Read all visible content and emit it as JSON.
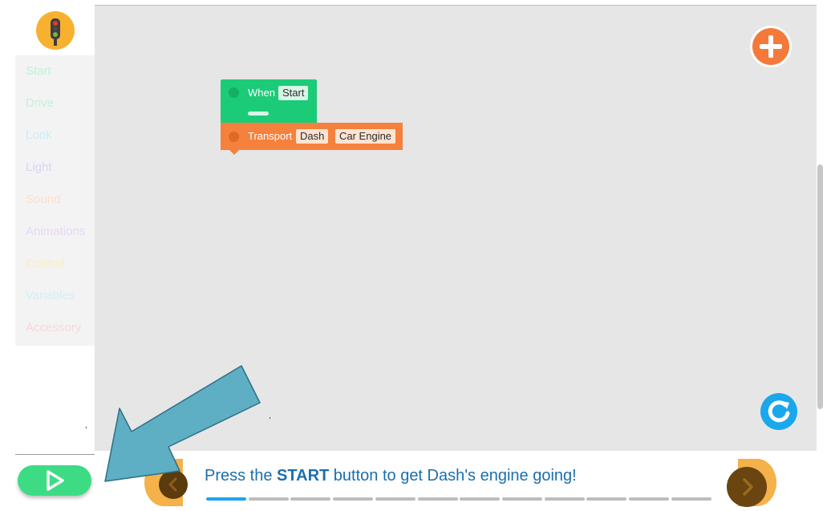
{
  "sidebar": {
    "logo_icon": "traffic-light-icon",
    "categories": [
      {
        "label": "Start",
        "color": "#bff3d8"
      },
      {
        "label": "Drive",
        "color": "#bff3d8"
      },
      {
        "label": "Look",
        "color": "#c8edf8"
      },
      {
        "label": "Light",
        "color": "#d6d6f4"
      },
      {
        "label": "Sound",
        "color": "#fde0cc"
      },
      {
        "label": "Animations",
        "color": "#e6d8f6"
      },
      {
        "label": "Control",
        "color": "#fdecc0"
      },
      {
        "label": "Variables",
        "color": "#d2eef7"
      },
      {
        "label": "Accessory",
        "color": "#fbd6da"
      }
    ]
  },
  "workspace": {
    "add_button_icon": "plus-icon",
    "reset_button_icon": "reset-icon",
    "blocks": {
      "when": {
        "label": "When",
        "field": "Start",
        "color": "#1ccb78"
      },
      "transport": {
        "label": "Transport",
        "field1": "Dash",
        "field2": "Car Engine",
        "color": "#f4813d"
      }
    }
  },
  "bottom_bar": {
    "play_button_icon": "play-icon",
    "prev_icon": "chevron-left-icon",
    "next_icon": "chevron-right-icon",
    "instruction": {
      "before": "Press the ",
      "bold": "START",
      "after": " button to get Dash's engine going!"
    },
    "progress": {
      "current_step": 1,
      "total_steps": 12
    }
  },
  "overlay": {
    "arrow_icon": "pointer-arrow-icon",
    "arrow_color": "#5eafc4"
  }
}
